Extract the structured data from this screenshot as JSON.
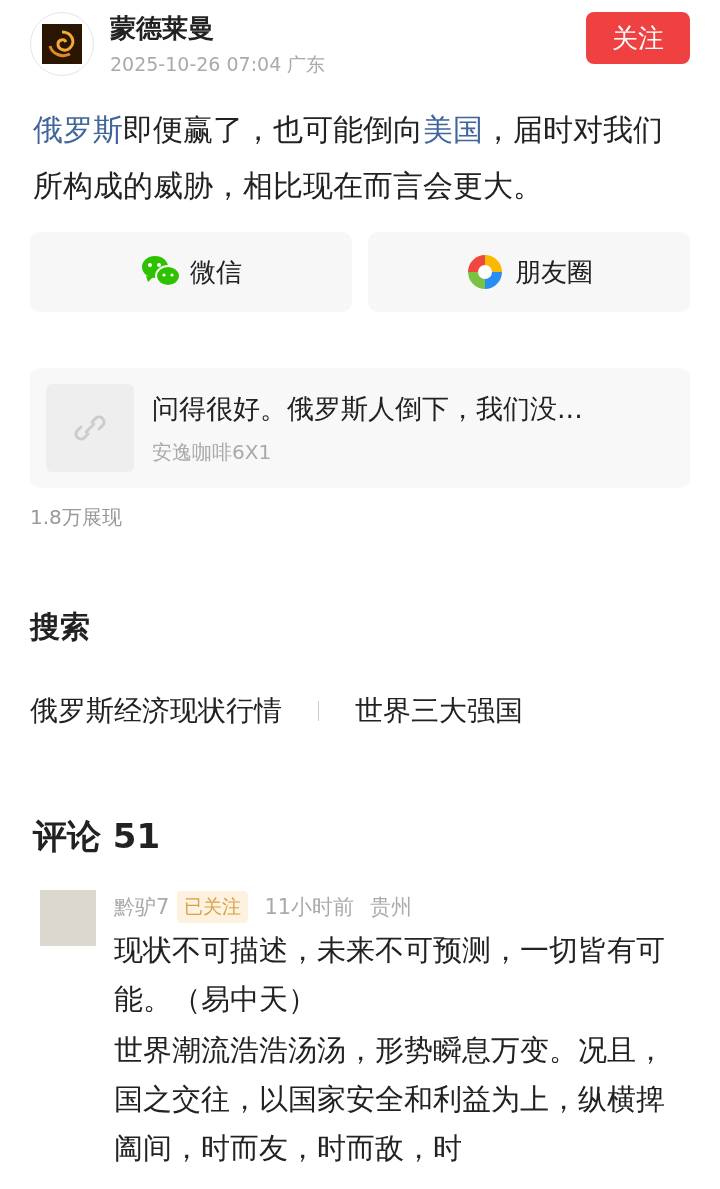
{
  "author": {
    "name": "蒙德莱曼",
    "meta": "2025-10-26 07:04  广东",
    "follow_label": "关注"
  },
  "post": {
    "segments": [
      {
        "kind": "link",
        "text": "俄罗斯"
      },
      {
        "kind": "text",
        "text": "即便赢了，也可能倒向"
      },
      {
        "kind": "link",
        "text": "美国"
      },
      {
        "kind": "text",
        "text": "，届时对我们所构成的威胁，相比现在而言会更大。"
      }
    ]
  },
  "share": [
    {
      "kind": "wechat",
      "label": "微信"
    },
    {
      "kind": "moments",
      "label": "朋友圈"
    }
  ],
  "linked_post": {
    "title": "问得很好。俄罗斯人倒下，我们没...",
    "source": "安逸咖啡6X1"
  },
  "views": "1.8万展现",
  "search": {
    "heading": "搜索",
    "items": [
      "俄罗斯经济现状行情",
      "世界三大强国"
    ]
  },
  "comments": {
    "heading": "评论 51",
    "items": [
      {
        "user": "黔驴7",
        "followed": true,
        "follow_label": "已关注",
        "time": "11小时前",
        "location": "贵州",
        "paragraphs": [
          "现状不可描述，未来不可预测，一切皆有可能。（易中天）",
          "世界潮流浩浩汤汤，形势瞬息万变。况且，国之交往，以国家安全和利益为上，纵横捭阖间，时而友，时而敌，时"
        ]
      }
    ]
  }
}
